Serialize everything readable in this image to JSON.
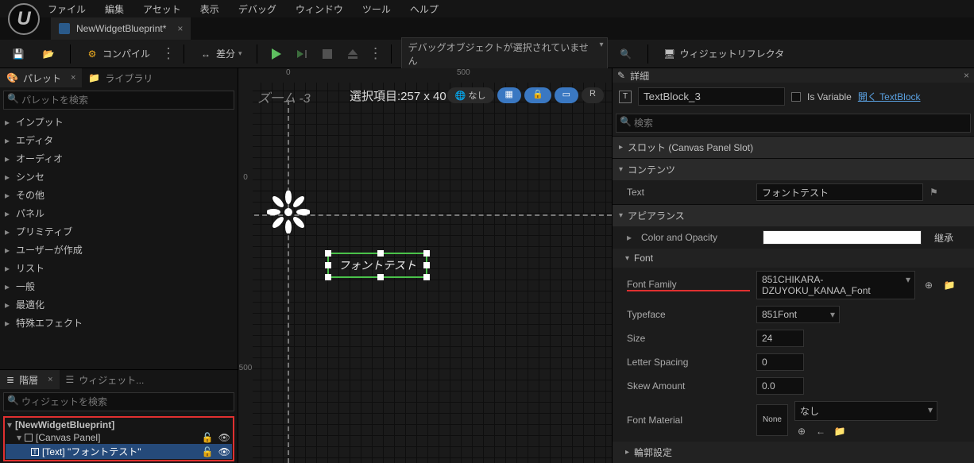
{
  "menubar": [
    "ファイル",
    "編集",
    "アセット",
    "表示",
    "デバッグ",
    "ウィンドウ",
    "ツール",
    "ヘルプ"
  ],
  "tab": {
    "title": "NewWidgetBlueprint*"
  },
  "toolbar": {
    "compile": "コンパイル",
    "diff": "差分",
    "debugObject": "デバッグオブジェクトが選択されていません",
    "widgetReflector": "ウィジェットリフレクタ"
  },
  "palette": {
    "tab": "パレット",
    "libraryTab": "ライブラリ",
    "searchPlaceholder": "パレットを検索",
    "items": [
      "インプット",
      "エディタ",
      "オーディオ",
      "シンセ",
      "その他",
      "パネル",
      "プリミティブ",
      "ユーザーが作成",
      "リスト",
      "一般",
      "最適化",
      "特殊エフェクト"
    ]
  },
  "hierarchy": {
    "tab": "階層",
    "widgetTab": "ウィジェット...",
    "searchPlaceholder": "ウィジェットを検索",
    "root": "[NewWidgetBlueprint]",
    "canvas": "[Canvas Panel]",
    "text": "[Text] \"フォントテスト\""
  },
  "viewport": {
    "zoom": "ズ一ム -3",
    "selection": "選択項目:257 x 40",
    "none": "なし",
    "r": "R",
    "ruler0": "0",
    "ruler500": "500",
    "rulerL0": "0",
    "rulerL500": "500",
    "widgetText": "フォントテスト"
  },
  "details": {
    "title": "詳細",
    "objectName": "TextBlock_3",
    "isVariable": "Is Variable",
    "openLink": "開く TextBlock",
    "searchPlaceholder": "検索",
    "sections": {
      "slot": "スロット (Canvas Panel Slot)",
      "content": "コンテンツ",
      "appearance": "アピアランス",
      "font": "Font",
      "outline": "輪郭設定"
    },
    "props": {
      "textLabel": "Text",
      "textValue": "フォントテスト",
      "colorOpacity": "Color and Opacity",
      "inherit": "継承",
      "fontFamily": "Font Family",
      "fontFamilyValue": "851CHIKARA-DZUYOKU_KANAA_Font",
      "typeface": "Typeface",
      "typefaceValue": "851Font",
      "size": "Size",
      "sizeValue": "24",
      "letterSpacing": "Letter Spacing",
      "letterSpacingValue": "0",
      "skew": "Skew Amount",
      "skewValue": "0.0",
      "fontMaterial": "Font Material",
      "none": "None",
      "noneJa": "なし"
    }
  }
}
